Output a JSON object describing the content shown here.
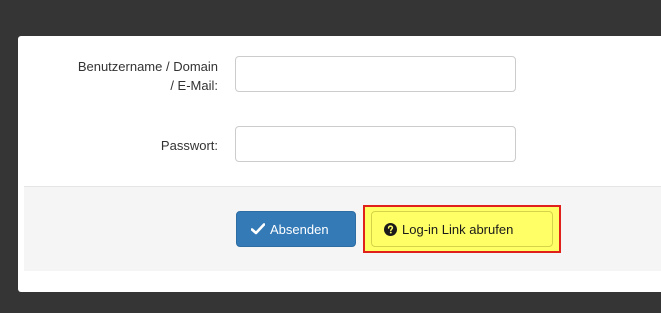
{
  "form": {
    "username_label_line1": "Benutzername / Domain",
    "username_label_line2": "/ E-Mail:",
    "username_value": "",
    "password_label": "Passwort:",
    "password_value": ""
  },
  "actions": {
    "submit_label": "Absenden",
    "submit_icon": "checkmark-icon",
    "login_link_label": "Log-in Link abrufen",
    "login_link_icon": "question-circle-icon"
  },
  "colors": {
    "primary": "#337ab7",
    "highlight_fill": "#ffff66",
    "highlight_border": "#e0201b"
  }
}
